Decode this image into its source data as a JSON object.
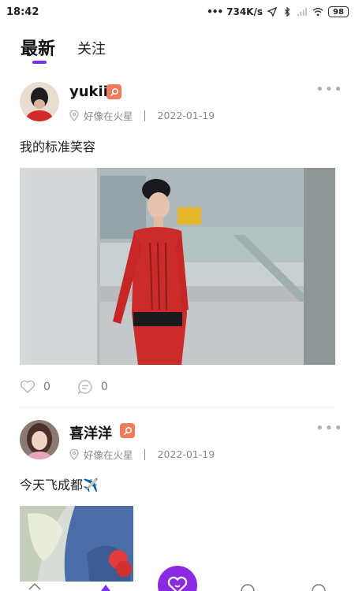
{
  "status_bar": {
    "time": "18:42",
    "net_speed": "734K/s",
    "battery": "98",
    "icons": [
      "dots-icon",
      "location-arrow-icon",
      "bluetooth-icon",
      "signal-icon",
      "wifi-icon",
      "battery-icon"
    ]
  },
  "tabs": [
    {
      "label": "最新",
      "active": true
    },
    {
      "label": "关注",
      "active": false
    }
  ],
  "accent_color": "#7b2ff7",
  "posts": [
    {
      "username": "yukii",
      "location": "好像在火星",
      "date": "2022-01-19",
      "text": "我的标准笑容",
      "likes": "0",
      "comments": "0",
      "image_desc_icon": "photo-image"
    },
    {
      "username": "喜洋洋",
      "location": "好像在火星",
      "date": "2022-01-19",
      "text": "今天飞成都✈️"
    }
  ],
  "fab_icon": "heart-chat-icon"
}
